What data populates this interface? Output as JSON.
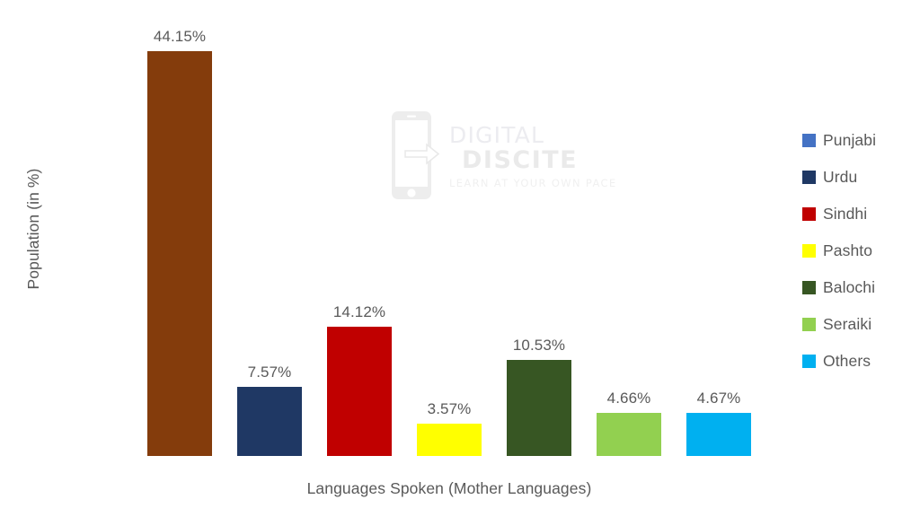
{
  "chart_data": {
    "type": "bar",
    "title": "",
    "xlabel": "Languages Spoken (Mother Languages)",
    "ylabel": "Population (in %)",
    "categories": [
      "Punjabi",
      "Urdu",
      "Sindhi",
      "Pashto",
      "Balochi",
      "Seraiki",
      "Others"
    ],
    "values": [
      44.15,
      7.57,
      14.12,
      3.57,
      10.53,
      4.66,
      4.67
    ],
    "value_labels": [
      "44.15%",
      "7.57%",
      "14.12%",
      "3.57%",
      "10.53%",
      "4.66%",
      "4.67%"
    ],
    "bar_colors": [
      "#843C0C",
      "#1F3864",
      "#C00000",
      "#FFFF00",
      "#375623",
      "#92D050",
      "#00B0F0"
    ],
    "ylim": [
      0,
      48
    ],
    "grid": false,
    "y_axis_ticks_visible": false,
    "legend_position": "right",
    "data_labels_position": "outside-end"
  },
  "legend": {
    "items": [
      {
        "label": "Punjabi",
        "color": "#4472C4"
      },
      {
        "label": "Urdu",
        "color": "#1F3864"
      },
      {
        "label": "Sindhi",
        "color": "#C00000"
      },
      {
        "label": "Pashto",
        "color": "#FFFF00"
      },
      {
        "label": "Balochi",
        "color": "#375623"
      },
      {
        "label": "Seraiki",
        "color": "#92D050"
      },
      {
        "label": "Others",
        "color": "#00B0F0"
      }
    ]
  },
  "watermark": {
    "line1": "DIGITAL",
    "line2": "DISCITE",
    "tagline": "LEARN AT YOUR OWN PACE",
    "logo": "phone-with-arrow-icon"
  },
  "colors": {
    "text": "#595959",
    "background": "#FFFFFF"
  }
}
